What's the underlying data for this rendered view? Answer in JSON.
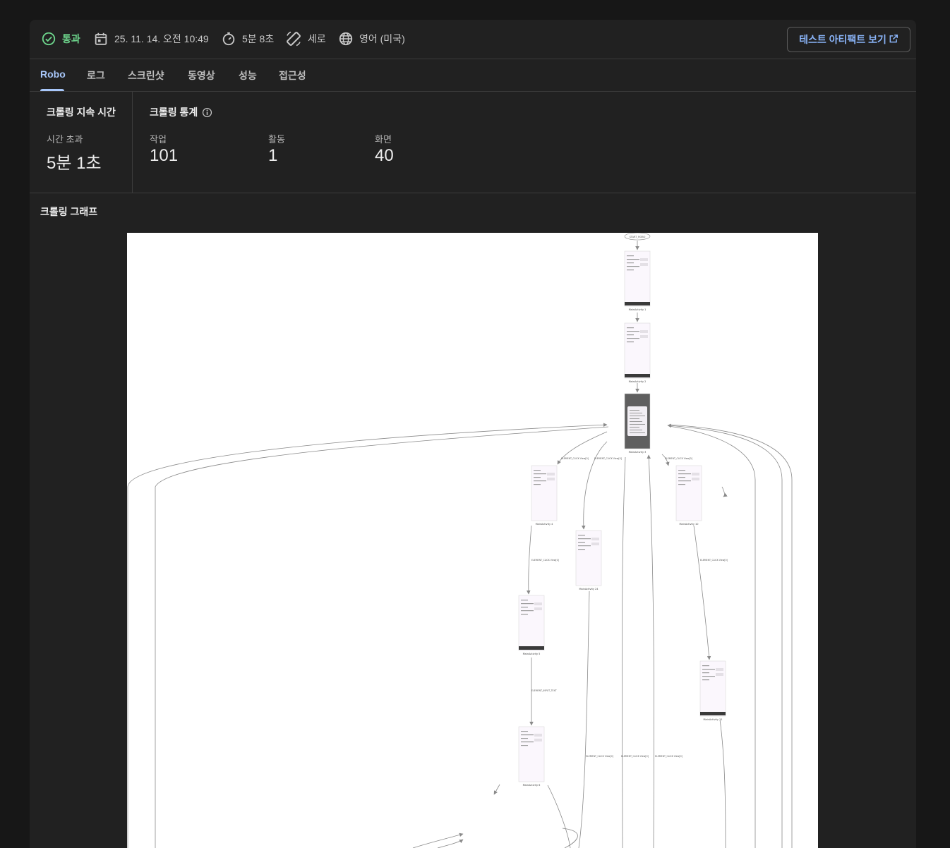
{
  "header": {
    "status": "통과",
    "datetime": "25. 11. 14. 오전 10:49",
    "duration": "5분 8초",
    "orientation": "세로",
    "locale": "영어 (미국)",
    "artifact_button": "테스트 아티팩트 보기",
    "icons": [
      "check-circle-icon",
      "calendar-icon",
      "timer-icon",
      "screen-rotation-icon",
      "globe-icon",
      "open-in-new-icon"
    ]
  },
  "tabs": [
    "Robo",
    "로그",
    "스크린샷",
    "동영상",
    "성능",
    "접근성"
  ],
  "active_tab": "Robo",
  "crawl_duration": {
    "title": "크롤링 지속 시간",
    "label": "시간 초과",
    "value": "5분 1초"
  },
  "crawl_stats": {
    "title": "크롤링 통계",
    "items": [
      {
        "label": "작업",
        "value": "101"
      },
      {
        "label": "활동",
        "value": "1"
      },
      {
        "label": "화면",
        "value": "40"
      }
    ]
  },
  "graph": {
    "title": "크롤링 그래프",
    "start_label": "START_ROBO",
    "nodes": [
      "MainActivity 1",
      "MainActivity 2",
      "MainActivity 3",
      "MainActivity 4",
      "MainActivity 10",
      "MainActivity 24",
      "MainActivity 5",
      "MainActivity 6",
      "MainActivity 11"
    ],
    "edges": [
      "ELEMENT_CLICK View[0]",
      "ELEMENT_CLICK View[0]",
      "ELEMENT_CLICK View[0]",
      "ELEMENT_CLICK View[0]",
      "ELEMENT_CLICK View[0]",
      "ELEMENT_INPUT_TEXT",
      "ELEMENT_CLICK View[0]",
      "ELEMENT_CLICK View[0]",
      "ELEMENT_CLICK View[0]"
    ],
    "colors": {
      "background": "#ffffff",
      "screen": "#fbf7fd",
      "dialog": "#5f5f5f",
      "edge": "#8a8a8a"
    }
  }
}
